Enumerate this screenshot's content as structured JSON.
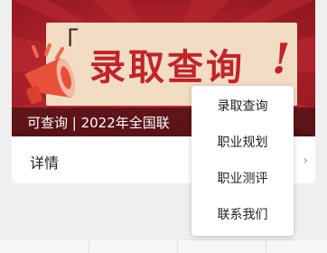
{
  "banner": {
    "title": "录取查询",
    "exclaim": "!",
    "quote_mark": "「",
    "caption": "可查询 | 2022年全国联"
  },
  "detail": {
    "label": "详情",
    "chevron": "›"
  },
  "menu": {
    "items": [
      {
        "label": "录取查询"
      },
      {
        "label": "职业规划"
      },
      {
        "label": "职业测评"
      },
      {
        "label": "联系我们"
      }
    ]
  },
  "colors": {
    "banner_red": "#a81f28",
    "title_red": "#c3232b",
    "panel_cream": "#f2dcc4"
  }
}
